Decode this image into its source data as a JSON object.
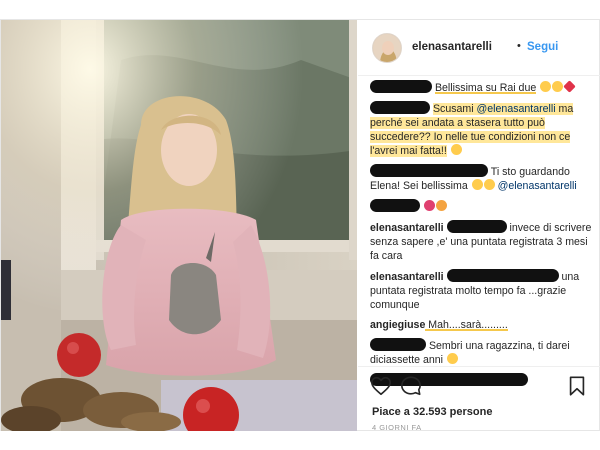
{
  "post": {
    "username": "elenasantarelli",
    "separator": "•",
    "follow_label": "Segui",
    "likes_text": "Piace a 32.593 persone",
    "time_text": "4 GIORNI FA"
  },
  "comments": [
    {
      "text": "Bellissima su Rai due"
    },
    {
      "text_a": "Scusami ",
      "mention": "@elenasantarelli",
      "text_b": " ma perché sei andata a stasera tutto può succedere?? Io nelle tue condizioni non ce l'avrei mai fatta!!"
    },
    {
      "text_a": "Ti sto guardando Elena! Sei bellissima",
      "mention": "@elenasantarelli"
    },
    {
      "user": "elenasantarelli",
      "text_b": " invece di scrivere senza sapere ,e' una puntata registrata 3 mesi fa cara"
    },
    {
      "user": "elenasantarelli",
      "text_b": " una puntata registrata molto tempo fa ...grazie comunque"
    },
    {
      "user": "angiegiuse",
      "text": " Mah....sarà........."
    },
    {
      "text_a": " Sembri una ragazzina, ti darei diciassette anni"
    }
  ],
  "icons": {
    "like": "heart-icon",
    "comment": "comment-icon",
    "save": "bookmark-icon"
  },
  "colors": {
    "link": "#3897f0",
    "highlight": "#ffe79a",
    "underline": "#f5c84c",
    "redaction": "#111111"
  }
}
